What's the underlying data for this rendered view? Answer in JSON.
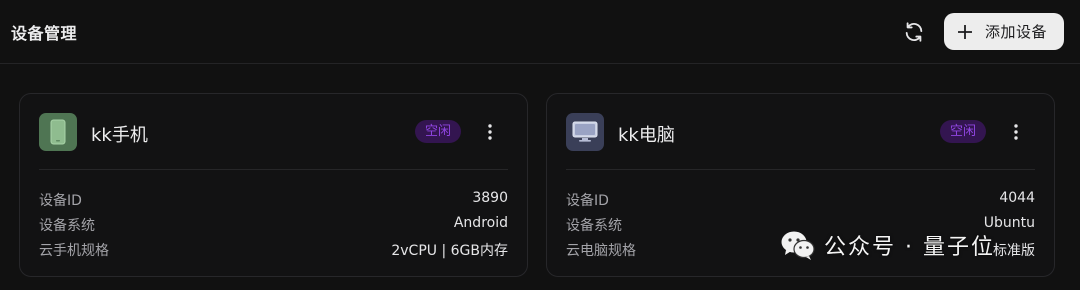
{
  "header": {
    "title": "设备管理",
    "refresh_icon": "refresh-icon",
    "add_device_label": "添加设备"
  },
  "devices": [
    {
      "icon": "phone-icon",
      "icon_bg": "#4f7553",
      "name": "kk手机",
      "status": "空闲",
      "status_color": "#8f45e0",
      "info": [
        {
          "key": "设备ID",
          "value": "3890"
        },
        {
          "key": "设备系统",
          "value": "Android"
        },
        {
          "key": "云手机规格",
          "value": "2vCPU | 6GB内存"
        }
      ]
    },
    {
      "icon": "monitor-icon",
      "icon_bg": "#3a3f58",
      "name": "kk电脑",
      "status": "空闲",
      "status_color": "#8f45e0",
      "info": [
        {
          "key": "设备ID",
          "value": "4044"
        },
        {
          "key": "设备系统",
          "value": "Ubuntu"
        },
        {
          "key": "云电脑规格",
          "value": "标准版"
        }
      ]
    }
  ],
  "watermark": {
    "text": "公众号 · 量子位",
    "icon": "wechat-icon"
  }
}
